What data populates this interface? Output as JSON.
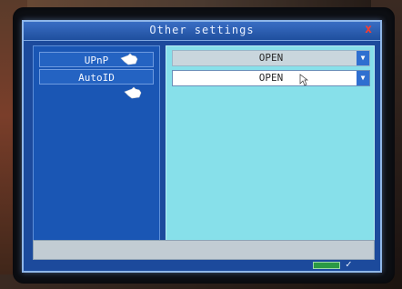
{
  "dialog": {
    "title": "Other settings",
    "close_icon": "close-icon",
    "close_glyph": "x"
  },
  "settings": [
    {
      "label": "UPnP",
      "value": "OPEN"
    },
    {
      "label": "AutoID",
      "value": "OPEN"
    }
  ],
  "dropdown_glyph": "▼",
  "check_glyph": "✓",
  "colors": {
    "dialog_bg": "#1c4a9c",
    "right_panel_bg": "#87e0ea",
    "close": "#ff3c2c"
  }
}
